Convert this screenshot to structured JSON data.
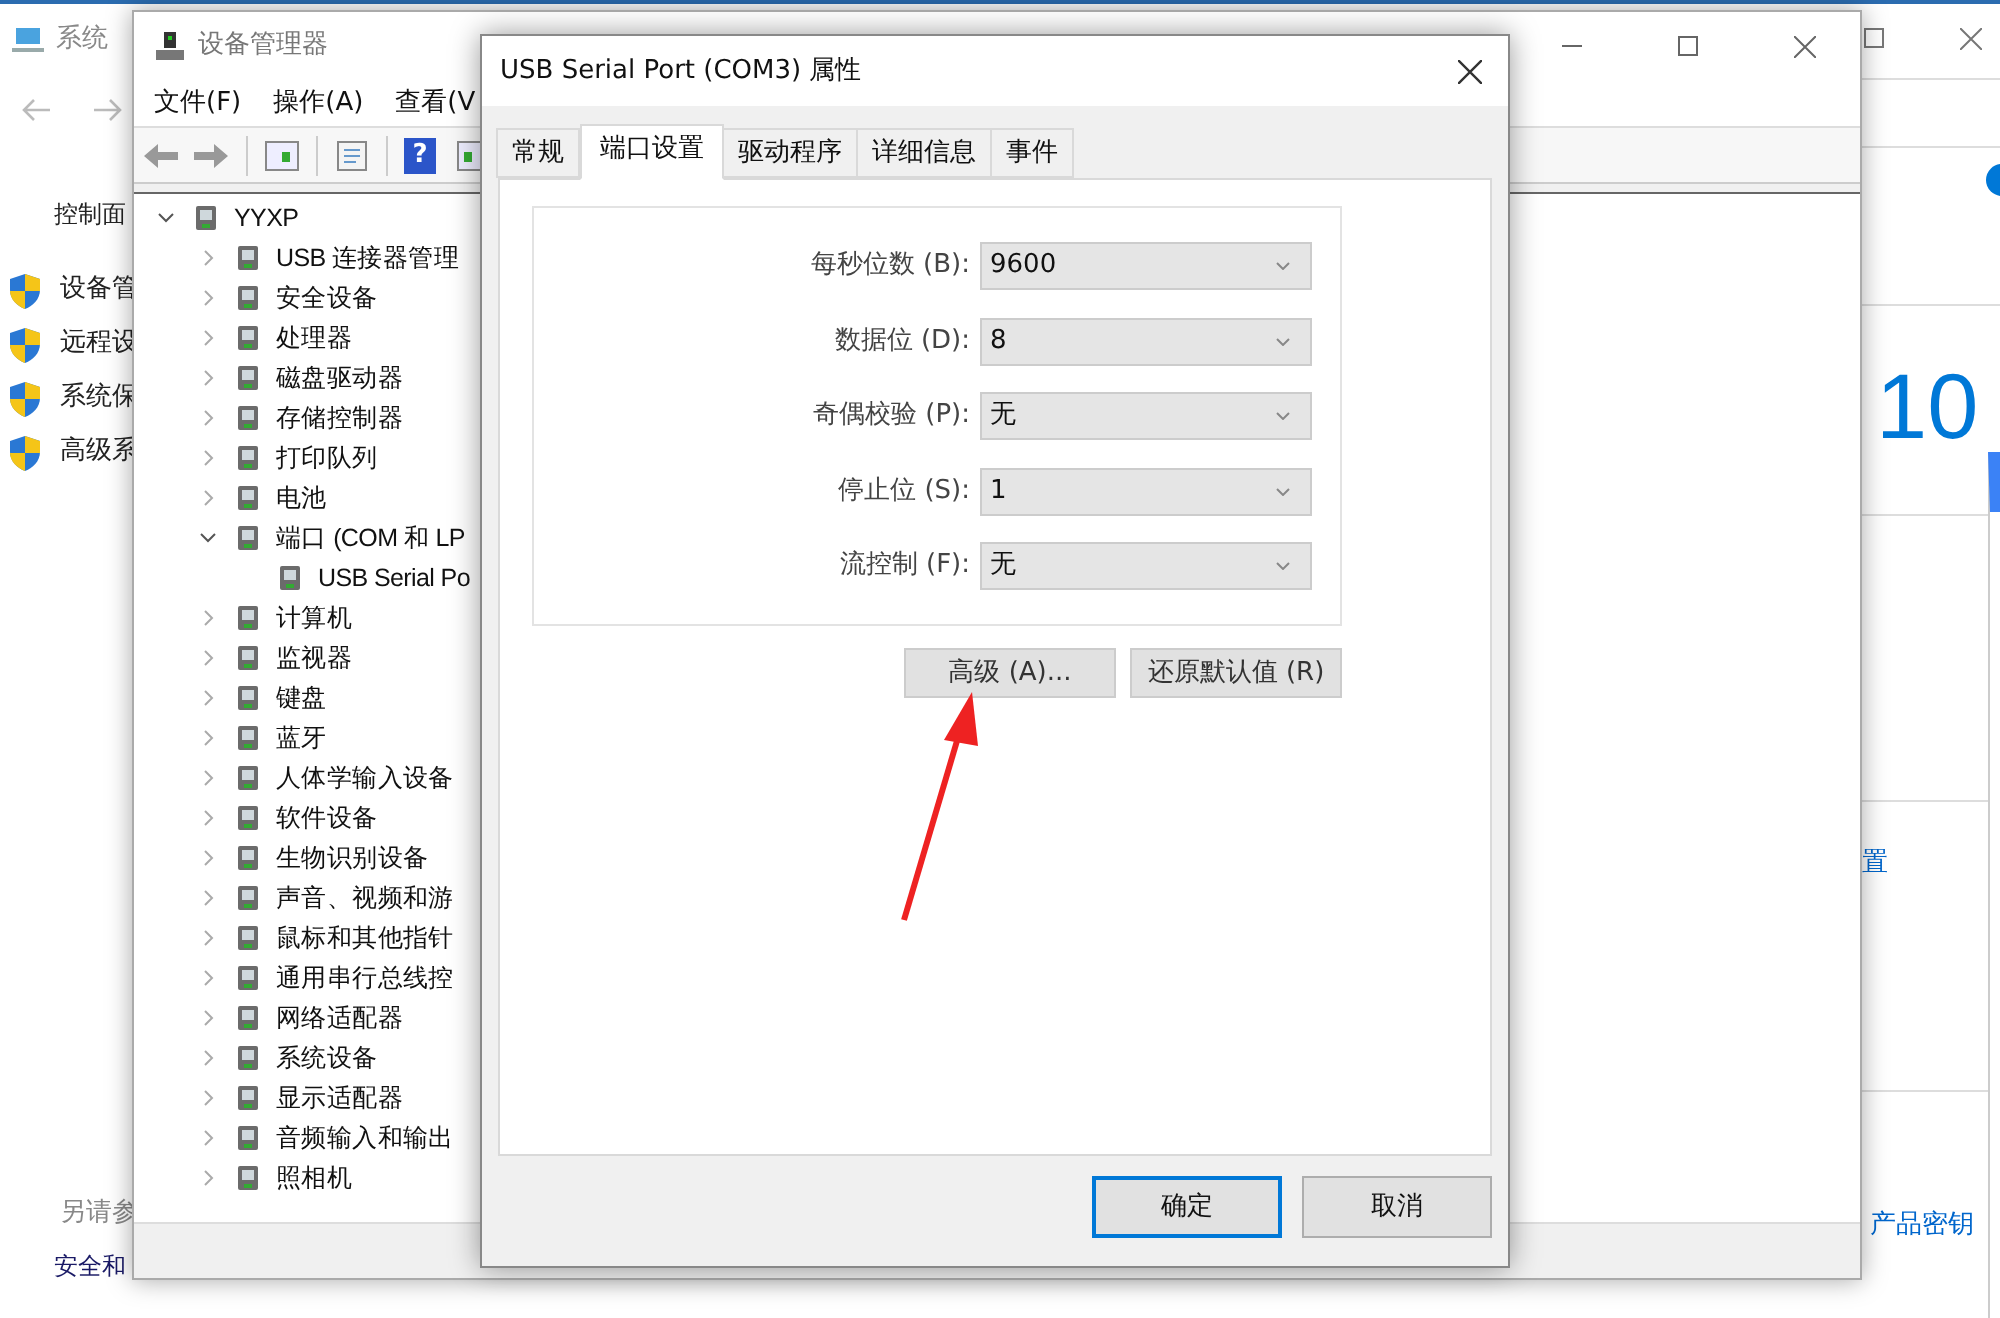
{
  "background_window": {
    "title": "系统",
    "nav_link": "控制面",
    "items": [
      "设备管",
      "远程设",
      "系统保",
      "高级系"
    ],
    "see_also": "另请参",
    "see_also_link": "安全和",
    "edition": "10",
    "links": [
      "置",
      "产品密钥"
    ]
  },
  "device_manager": {
    "title": "设备管理器",
    "menu": [
      "文件(F)",
      "操作(A)",
      "查看(V"
    ],
    "help_glyph": "?",
    "tree": {
      "label": "YYXP",
      "expanded": true,
      "children": [
        {
          "label": "USB 连接器管理",
          "expanded": false
        },
        {
          "label": "安全设备",
          "expanded": false
        },
        {
          "label": "处理器",
          "expanded": false
        },
        {
          "label": "磁盘驱动器",
          "expanded": false
        },
        {
          "label": "存储控制器",
          "expanded": false
        },
        {
          "label": "打印队列",
          "expanded": false
        },
        {
          "label": "电池",
          "expanded": false
        },
        {
          "label": "端口 (COM 和 LP",
          "expanded": true,
          "children": [
            {
              "label": "USB Serial Po"
            }
          ]
        },
        {
          "label": "计算机",
          "expanded": false
        },
        {
          "label": "监视器",
          "expanded": false
        },
        {
          "label": "键盘",
          "expanded": false
        },
        {
          "label": "蓝牙",
          "expanded": false
        },
        {
          "label": "人体学输入设备",
          "expanded": false
        },
        {
          "label": "软件设备",
          "expanded": false
        },
        {
          "label": "生物识别设备",
          "expanded": false
        },
        {
          "label": "声音、视频和游",
          "expanded": false
        },
        {
          "label": "鼠标和其他指针",
          "expanded": false
        },
        {
          "label": "通用串行总线控",
          "expanded": false
        },
        {
          "label": "网络适配器",
          "expanded": false
        },
        {
          "label": "系统设备",
          "expanded": false
        },
        {
          "label": "显示适配器",
          "expanded": false
        },
        {
          "label": "音频输入和输出",
          "expanded": false
        },
        {
          "label": "照相机",
          "expanded": false
        }
      ]
    }
  },
  "dialog": {
    "title": "USB Serial Port (COM3) 属性",
    "tabs": [
      {
        "label": "常规",
        "selected": false
      },
      {
        "label": "端口设置",
        "selected": true
      },
      {
        "label": "驱动程序",
        "selected": false
      },
      {
        "label": "详细信息",
        "selected": false
      },
      {
        "label": "事件",
        "selected": false
      }
    ],
    "fields": [
      {
        "label": "每秒位数 (B):",
        "value": "9600"
      },
      {
        "label": "数据位 (D):",
        "value": "8"
      },
      {
        "label": "奇偶校验 (P):",
        "value": "无"
      },
      {
        "label": "停止位 (S):",
        "value": "1"
      },
      {
        "label": "流控制 (F):",
        "value": "无"
      }
    ],
    "buttons": [
      "高级 (A)...",
      "还原默认值 (R)"
    ],
    "footer_buttons": [
      {
        "label": "确定",
        "default": true
      },
      {
        "label": "取消",
        "default": false
      }
    ]
  }
}
